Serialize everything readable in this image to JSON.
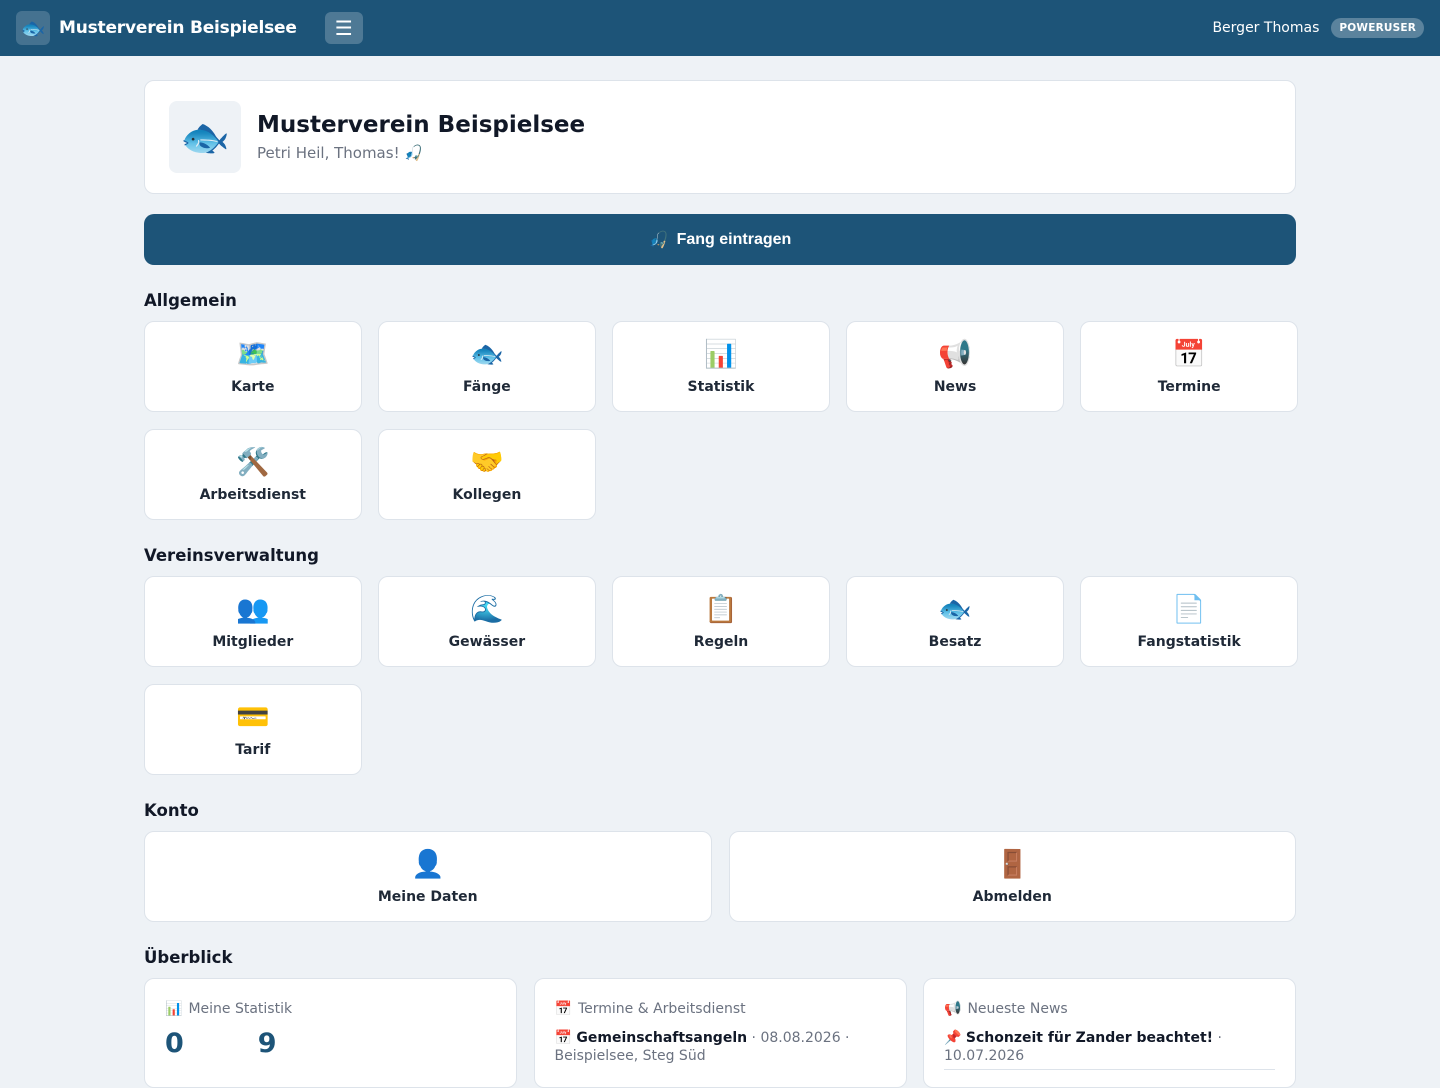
{
  "topbar": {
    "brand_icon": "fish-icon",
    "brand_glyph": "🐟",
    "brand_name": "Musterverein Beispielsee",
    "menu_icon": "hamburger-icon",
    "menu_glyph": "☰",
    "user_name": "Berger Thomas",
    "role": "POWERUSER"
  },
  "club": {
    "logo_glyph": "🐟",
    "title": "Musterverein Beispielsee",
    "greeting": "Petri Heil, Thomas! 🎣"
  },
  "cta": {
    "glyph": "🎣",
    "label": "Fang eintragen"
  },
  "sections": {
    "allgemein": {
      "title": "Allgemein",
      "items": [
        {
          "glyph": "🗺️",
          "icon": "map-icon",
          "label": "Karte"
        },
        {
          "glyph": "🐟",
          "icon": "fish-icon",
          "label": "Fänge"
        },
        {
          "glyph": "📊",
          "icon": "bar-chart-icon",
          "label": "Statistik"
        },
        {
          "glyph": "📢",
          "icon": "megaphone-icon",
          "label": "News"
        },
        {
          "glyph": "📅",
          "icon": "calendar-icon",
          "label": "Termine"
        },
        {
          "glyph": "🛠️",
          "icon": "tools-icon",
          "label": "Arbeitsdienst"
        },
        {
          "glyph": "🤝",
          "icon": "handshake-icon",
          "label": "Kollegen"
        }
      ]
    },
    "verwaltung": {
      "title": "Vereinsverwaltung",
      "items": [
        {
          "glyph": "👥",
          "icon": "members-icon",
          "label": "Mitglieder"
        },
        {
          "glyph": "🌊",
          "icon": "wave-icon",
          "label": "Gewässer"
        },
        {
          "glyph": "📋",
          "icon": "clipboard-icon",
          "label": "Regeln"
        },
        {
          "glyph": "🐟",
          "icon": "fish-icon",
          "label": "Besatz"
        },
        {
          "glyph": "📄",
          "icon": "document-icon",
          "label": "Fangstatistik"
        },
        {
          "glyph": "💳",
          "icon": "credit-card-icon",
          "label": "Tarif"
        }
      ]
    },
    "konto": {
      "title": "Konto",
      "items": [
        {
          "glyph": "👤",
          "icon": "user-icon",
          "label": "Meine Daten"
        },
        {
          "glyph": "🚪",
          "icon": "door-icon",
          "label": "Abmelden"
        }
      ]
    },
    "ueberblick": {
      "title": "Überblick"
    }
  },
  "overview": {
    "stats": {
      "glyph": "📊",
      "title": "Meine Statistik",
      "value1": "0",
      "value2": "9"
    },
    "events": {
      "glyph": "📅",
      "title": "Termine & Arbeitsdienst",
      "item_glyph": "📅",
      "item_title": "Gemeinschaftsangeln",
      "item_meta": "· 08.08.2026 · Beispielsee, Steg Süd"
    },
    "news": {
      "glyph": "📢",
      "title": "Neueste News",
      "item_glyph": "📌",
      "item_title": "Schonzeit für Zander beachtet!",
      "item_meta": "· 10.07.2026"
    }
  }
}
